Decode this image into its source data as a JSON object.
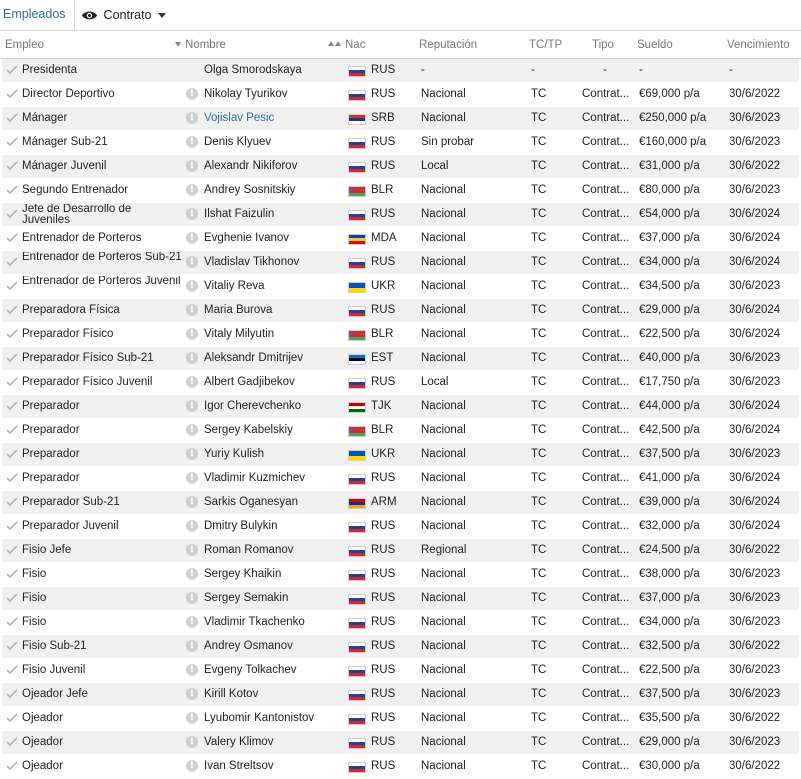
{
  "toolbar": {
    "tab_label": "Empleados",
    "view_label": "Contrato",
    "view_icon": "eye-icon"
  },
  "columns": {
    "empleo": "Empleo",
    "nombre": "Nombre",
    "nac": "Nac",
    "reputacion": "Reputación",
    "tctp": "TC/TP",
    "tipo": "Tipo",
    "sueldo": "Sueldo",
    "vencimiento": "Vencimiento"
  },
  "flag_colors": {
    "RUS": [
      "#ffffff",
      "#1c3fa8",
      "#d52b1e"
    ],
    "SRB": [
      "#c6363c",
      "#0c4077",
      "#ffffff"
    ],
    "BLR": [
      "#c8313e",
      "#c8313e",
      "#4aa657"
    ],
    "MDA": [
      "#0046ae",
      "#ffd200",
      "#cc092f"
    ],
    "UKR": [
      "#0057b7",
      "#ffd700"
    ],
    "EST": [
      "#0072ce",
      "#000000",
      "#ffffff"
    ],
    "TJK": [
      "#cc0000",
      "#ffffff",
      "#006600"
    ],
    "ARM": [
      "#d90012",
      "#0033a0",
      "#f2a800"
    ]
  },
  "rows": [
    {
      "role": "Presidenta",
      "name": "Olga Smorodskaya",
      "info": false,
      "nat": "RUS",
      "rep": "-",
      "tctp": "-",
      "tipo": "-",
      "sueldo": "-",
      "venc": "-"
    },
    {
      "role": "Director Deportivo",
      "name": "Nikolay Tyurikov",
      "info": true,
      "nat": "RUS",
      "rep": "Nacional",
      "tctp": "TC",
      "tipo": "Contrat...",
      "sueldo": "€69,000 p/a",
      "venc": "30/6/2022"
    },
    {
      "role": "Mánager",
      "name": "Vojislav Pesic",
      "info": true,
      "link": true,
      "nat": "SRB",
      "rep": "Nacional",
      "tctp": "TC",
      "tipo": "Contrat...",
      "sueldo": "€250,000 p/a",
      "venc": "30/6/2023"
    },
    {
      "role": "Mánager Sub-21",
      "name": "Denis Klyuev",
      "info": true,
      "nat": "RUS",
      "rep": "Sin probar",
      "tctp": "TC",
      "tipo": "Contrat...",
      "sueldo": "€160,000 p/a",
      "venc": "30/6/2023"
    },
    {
      "role": "Mánager Juvenil",
      "name": "Alexandr Nikiforov",
      "info": true,
      "nat": "RUS",
      "rep": "Local",
      "tctp": "TC",
      "tipo": "Contrat...",
      "sueldo": "€31,000 p/a",
      "venc": "30/6/2022"
    },
    {
      "role": "Segundo Entrenador",
      "name": "Andrey Sosnitskiy",
      "info": true,
      "nat": "BLR",
      "rep": "Nacional",
      "tctp": "TC",
      "tipo": "Contrat...",
      "sueldo": "€80,000 p/a",
      "venc": "30/6/2023"
    },
    {
      "role": "Jefe de Desarrollo de Juveniles",
      "name": "Ilshat Faizulin",
      "info": true,
      "nat": "RUS",
      "rep": "Nacional",
      "tctp": "TC",
      "tipo": "Contrat...",
      "sueldo": "€54,000 p/a",
      "venc": "30/6/2024",
      "two_line": true
    },
    {
      "role": "Entrenador de Porteros",
      "name": "Evghenie Ivanov",
      "info": true,
      "nat": "MDA",
      "rep": "Nacional",
      "tctp": "TC",
      "tipo": "Contrat...",
      "sueldo": "€37,000 p/a",
      "venc": "30/6/2024"
    },
    {
      "role": "Entrenador de Porteros Sub-21",
      "name": "Vladislav Tikhonov",
      "info": true,
      "nat": "RUS",
      "rep": "Nacional",
      "tctp": "TC",
      "tipo": "Contrat...",
      "sueldo": "€34,000 p/a",
      "venc": "30/6/2024",
      "two_line": true
    },
    {
      "role": "Entrenador de Porteros Juvenil",
      "name": "Vitaliy Reva",
      "info": true,
      "nat": "UKR",
      "rep": "Nacional",
      "tctp": "TC",
      "tipo": "Contrat...",
      "sueldo": "€34,500 p/a",
      "venc": "30/6/2023",
      "two_line": true
    },
    {
      "role": "Preparadora Física",
      "name": "Maria Burova",
      "info": true,
      "nat": "RUS",
      "rep": "Nacional",
      "tctp": "TC",
      "tipo": "Contrat...",
      "sueldo": "€29,000 p/a",
      "venc": "30/6/2024"
    },
    {
      "role": "Preparador Físico",
      "name": "Vitaly Milyutin",
      "info": true,
      "nat": "BLR",
      "rep": "Nacional",
      "tctp": "TC",
      "tipo": "Contrat...",
      "sueldo": "€22,500 p/a",
      "venc": "30/6/2024"
    },
    {
      "role": "Preparador Físico Sub-21",
      "name": "Aleksandr Dmitrijev",
      "info": true,
      "nat": "EST",
      "rep": "Nacional",
      "tctp": "TC",
      "tipo": "Contrat...",
      "sueldo": "€40,000 p/a",
      "venc": "30/6/2023"
    },
    {
      "role": "Preparador Físico Juvenil",
      "name": "Albert Gadjibekov",
      "info": true,
      "nat": "RUS",
      "rep": "Local",
      "tctp": "TC",
      "tipo": "Contrat...",
      "sueldo": "€17,750 p/a",
      "venc": "30/6/2023"
    },
    {
      "role": "Preparador",
      "name": "Igor Cherevchenko",
      "info": true,
      "nat": "TJK",
      "rep": "Nacional",
      "tctp": "TC",
      "tipo": "Contrat...",
      "sueldo": "€44,000 p/a",
      "venc": "30/6/2024"
    },
    {
      "role": "Preparador",
      "name": "Sergey Kabelskiy",
      "info": true,
      "nat": "BLR",
      "rep": "Nacional",
      "tctp": "TC",
      "tipo": "Contrat...",
      "sueldo": "€42,500 p/a",
      "venc": "30/6/2024"
    },
    {
      "role": "Preparador",
      "name": "Yuriy Kulish",
      "info": true,
      "nat": "UKR",
      "rep": "Nacional",
      "tctp": "TC",
      "tipo": "Contrat...",
      "sueldo": "€37,500 p/a",
      "venc": "30/6/2023"
    },
    {
      "role": "Preparador",
      "name": "Vladimir Kuzmichev",
      "info": true,
      "nat": "RUS",
      "rep": "Nacional",
      "tctp": "TC",
      "tipo": "Contrat...",
      "sueldo": "€41,000 p/a",
      "venc": "30/6/2024"
    },
    {
      "role": "Preparador Sub-21",
      "name": "Sarkis Oganesyan",
      "info": true,
      "nat": "ARM",
      "rep": "Nacional",
      "tctp": "TC",
      "tipo": "Contrat...",
      "sueldo": "€39,000 p/a",
      "venc": "30/6/2024"
    },
    {
      "role": "Preparador Juvenil",
      "name": "Dmitry Bulykin",
      "info": true,
      "nat": "RUS",
      "rep": "Nacional",
      "tctp": "TC",
      "tipo": "Contrat...",
      "sueldo": "€32,000 p/a",
      "venc": "30/6/2024"
    },
    {
      "role": "Fisio Jefe",
      "name": "Roman Romanov",
      "info": true,
      "nat": "RUS",
      "rep": "Regional",
      "tctp": "TC",
      "tipo": "Contrat...",
      "sueldo": "€24,500 p/a",
      "venc": "30/6/2022"
    },
    {
      "role": "Fisio",
      "name": "Sergey Khaikin",
      "info": true,
      "nat": "RUS",
      "rep": "Nacional",
      "tctp": "TC",
      "tipo": "Contrat...",
      "sueldo": "€38,000 p/a",
      "venc": "30/6/2023"
    },
    {
      "role": "Fisio",
      "name": "Sergey Semakin",
      "info": true,
      "nat": "RUS",
      "rep": "Nacional",
      "tctp": "TC",
      "tipo": "Contrat...",
      "sueldo": "€37,000 p/a",
      "venc": "30/6/2023"
    },
    {
      "role": "Fisio",
      "name": "Vladimir Tkachenko",
      "info": true,
      "nat": "RUS",
      "rep": "Nacional",
      "tctp": "TC",
      "tipo": "Contrat...",
      "sueldo": "€34,000 p/a",
      "venc": "30/6/2023"
    },
    {
      "role": "Fisio Sub-21",
      "name": "Andrey Osmanov",
      "info": true,
      "nat": "RUS",
      "rep": "Nacional",
      "tctp": "TC",
      "tipo": "Contrat...",
      "sueldo": "€32,500 p/a",
      "venc": "30/6/2022"
    },
    {
      "role": "Fisio Juvenil",
      "name": "Evgeny Tolkachev",
      "info": true,
      "nat": "RUS",
      "rep": "Nacional",
      "tctp": "TC",
      "tipo": "Contrat...",
      "sueldo": "€22,500 p/a",
      "venc": "30/6/2023"
    },
    {
      "role": "Ojeador Jefe",
      "name": "Kirill Kotov",
      "info": true,
      "nat": "RUS",
      "rep": "Nacional",
      "tctp": "TC",
      "tipo": "Contrat...",
      "sueldo": "€37,500 p/a",
      "venc": "30/6/2023"
    },
    {
      "role": "Ojeador",
      "name": "Lyubomir Kantonistov",
      "info": true,
      "nat": "RUS",
      "rep": "Nacional",
      "tctp": "TC",
      "tipo": "Contrat...",
      "sueldo": "€35,500 p/a",
      "venc": "30/6/2022"
    },
    {
      "role": "Ojeador",
      "name": "Valery Klimov",
      "info": true,
      "nat": "RUS",
      "rep": "Nacional",
      "tctp": "TC",
      "tipo": "Contrat...",
      "sueldo": "€29,000 p/a",
      "venc": "30/6/2023"
    },
    {
      "role": "Ojeador",
      "name": "Ivan Streltsov",
      "info": true,
      "nat": "RUS",
      "rep": "Nacional",
      "tctp": "TC",
      "tipo": "Contrat...",
      "sueldo": "€30,000 p/a",
      "venc": "30/6/2022"
    }
  ]
}
